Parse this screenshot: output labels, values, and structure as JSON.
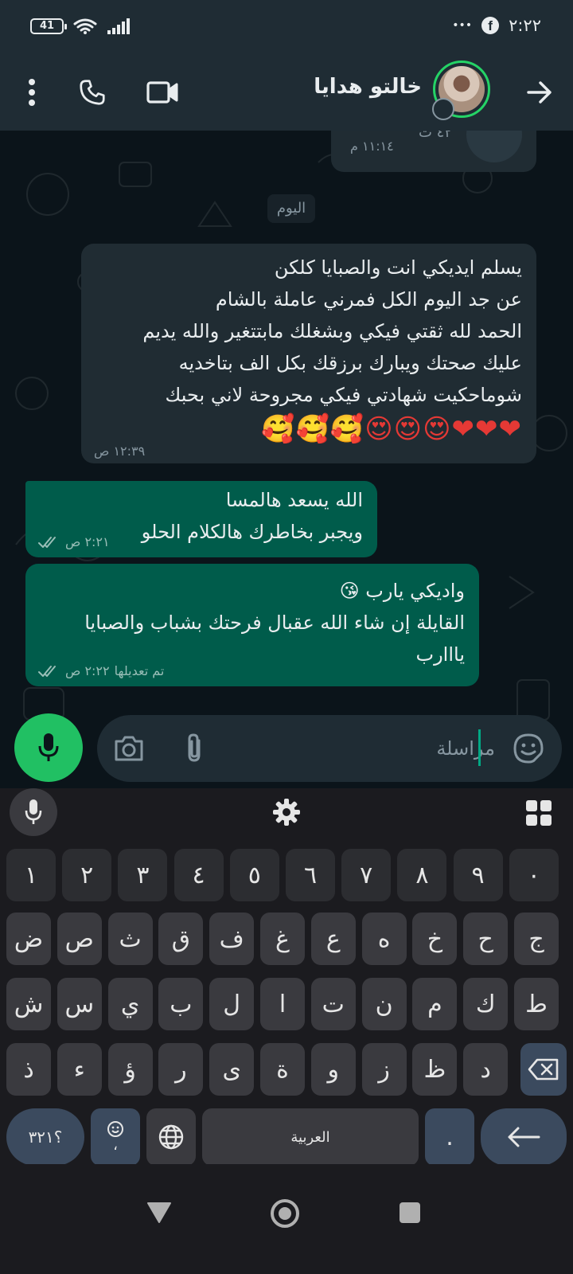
{
  "status_bar": {
    "battery": "41",
    "time": "٢:٢٢",
    "more": "•••"
  },
  "header": {
    "contact_name": "خالتو هدايا"
  },
  "chat": {
    "prev_message": {
      "duration": "٤٢ ث",
      "time": "١١:١٤ م"
    },
    "date_chip": "اليوم",
    "messages": [
      {
        "direction": "incoming",
        "lines": [
          "يسلم ايديكي انت والصبايا كلكن",
          "عن جد اليوم الكل فمرني عاملة بالشام",
          "الحمد لله ثقتي فيكي وبشغلك مابتتغير والله يديم",
          "عليك صحتك ويبارك برزقك بكل الف بتاخديه",
          "شوماحكيت شهادتي فيكي مجروحة لاني بحبك"
        ],
        "emoji": "❤❤❤😍😍😍🥰🥰🥰",
        "time": "١٢:٣٩ ص"
      },
      {
        "direction": "outgoing",
        "lines": [
          "الله يسعد هالمسا",
          "ويجبر بخاطرك هالكلام الحلو"
        ],
        "time": "٢:٢١ ص"
      },
      {
        "direction": "outgoing",
        "lines": [
          "واديكي يارب 😘",
          "القايلة إن شاء الله عقبال فرحتك بشباب والصبايا",
          "يااارب"
        ],
        "edited": "تم تعديلها",
        "time": "٢:٢٢ ص"
      }
    ]
  },
  "compose": {
    "placeholder": "مراسلة"
  },
  "keyboard": {
    "row_numbers": [
      "١",
      "٢",
      "٣",
      "٤",
      "٥",
      "٦",
      "٧",
      "٨",
      "٩",
      "٠"
    ],
    "row1": [
      "ض",
      "ص",
      "ث",
      "ق",
      "ف",
      "غ",
      "ع",
      "ه",
      "خ",
      "ح",
      "ج"
    ],
    "row2": [
      "ش",
      "س",
      "ي",
      "ب",
      "ل",
      "ا",
      "ت",
      "ن",
      "م",
      "ك",
      "ط"
    ],
    "row3": [
      "ذ",
      "ء",
      "ؤ",
      "ر",
      "ى",
      "ة",
      "و",
      "ز",
      "ظ",
      "د"
    ],
    "symbols_key": "؟٣٢١",
    "emoji_key_sub": "،",
    "space_label": "العربية",
    "dot_key": "."
  },
  "colors": {
    "header_bg": "#1f2c34",
    "chat_bg": "#0b141a",
    "incoming_bubble": "#202c33",
    "outgoing_bubble": "#005c4b",
    "accent_green": "#21c063",
    "keyboard_bg": "#1b1b1f"
  }
}
